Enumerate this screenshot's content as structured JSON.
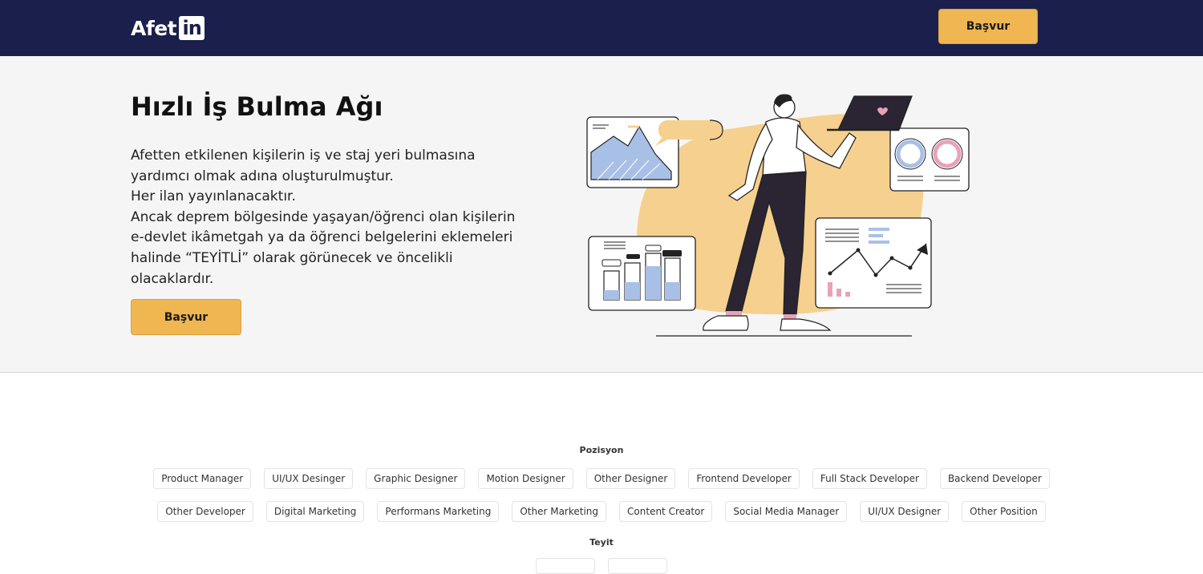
{
  "navbar": {
    "logo_text": "Afet",
    "logo_badge": "in",
    "apply_label": "Başvur",
    "bg_color": "#1a1f4b",
    "accent_color": "#f0b651"
  },
  "hero": {
    "title": "Hızlı İş Bulma Ağı",
    "description_lines": [
      "Afetten etkilenen kişilerin iş ve staj yeri bulmasına yardımcı olmak adına oluşturulmuştur.",
      "Her ilan yayınlanacaktır.",
      "Ancak deprem bölgesinde yaşayan/öğrenci olan kişilerin e-devlet ikâmetgah ya da öğrenci belgelerini eklemeleri halinde “TEYİTLİ” olarak görünecek ve öncelikli olacaklardır."
    ],
    "apply_label": "Başvur"
  },
  "filters": {
    "position_title": "Pozisyon",
    "positions_row1": [
      "Product Manager",
      "UI/UX Desinger",
      "Graphic Designer",
      "Motion Designer",
      "Other Designer",
      "Frontend Developer",
      "Full Stack Developer",
      "Backend Developer"
    ],
    "positions_row2": [
      "Other Developer",
      "Digital Marketing",
      "Performans Marketing",
      "Other Marketing",
      "Content Creator",
      "Social Media Manager",
      "UI/UX Designer",
      "Other Position"
    ],
    "verification_title": "Teyit"
  }
}
